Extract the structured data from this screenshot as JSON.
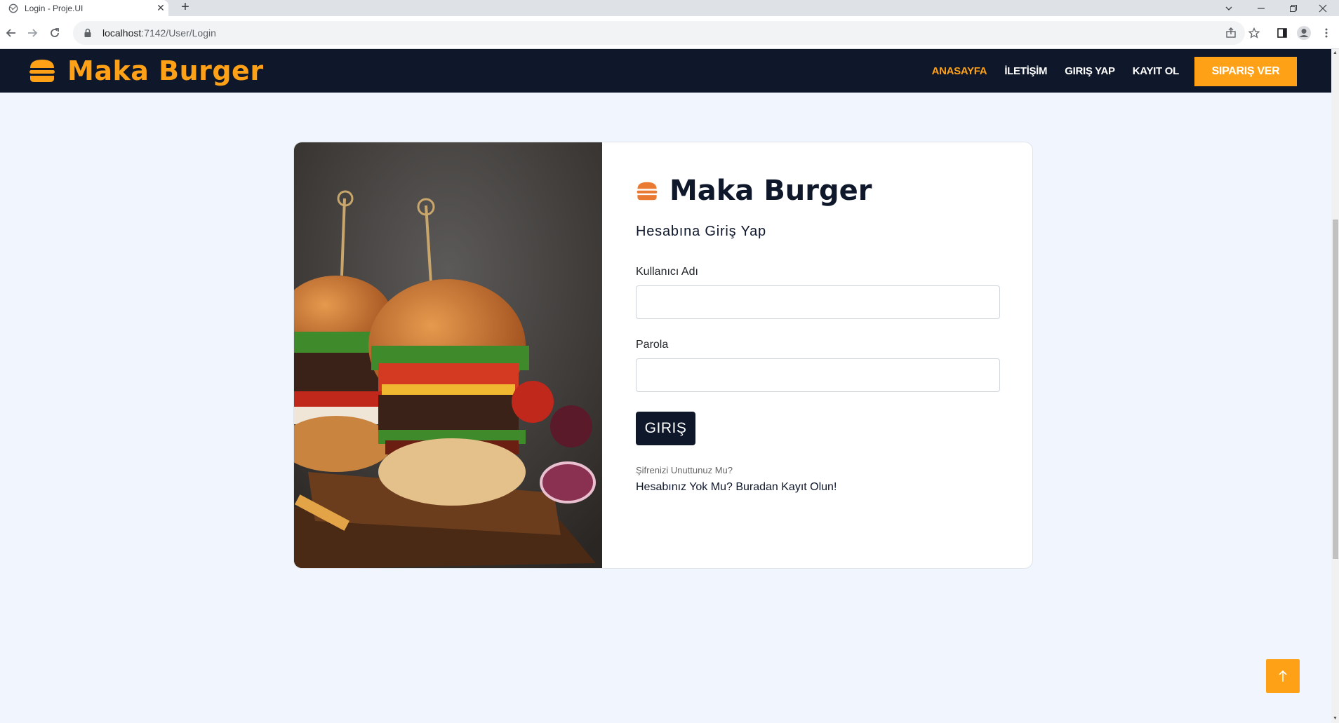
{
  "browser": {
    "tab_title": "Login - Proje.UI",
    "tab_close": "✕",
    "new_tab": "+",
    "url_host": "localhost",
    "url_path": ":7142/User/Login",
    "icons": [
      "globe-icon",
      "back-arrow-icon",
      "forward-arrow-icon",
      "reload-icon",
      "lock-icon",
      "share-icon",
      "star-icon",
      "sidepanel-icon",
      "profile-icon",
      "kebab-menu-icon",
      "chevron-down-icon",
      "minimize-icon",
      "restore-icon",
      "close-icon"
    ]
  },
  "navbar": {
    "brand": "Maka Burger",
    "links": [
      {
        "label": "ANASAYFA",
        "active": true
      },
      {
        "label": "İLETİŞİM",
        "active": false
      },
      {
        "label": "GIRIŞ YAP",
        "active": false
      },
      {
        "label": "KAYIT OL",
        "active": false
      }
    ],
    "order_button": "SIPARIŞ VER"
  },
  "login": {
    "brand": "Maka Burger",
    "subtitle": "Hesabına Giriş Yap",
    "username_label": "Kullanıcı Adı",
    "username_value": "",
    "password_label": "Parola",
    "password_value": "",
    "submit_label": "GIRIŞ",
    "forgot_link": "Şifrenizi Unuttunuz Mu?",
    "register_link": "Hesabınız Yok Mu? Buradan Kayıt Olun!"
  },
  "colors": {
    "accent": "#fea116",
    "dark": "#0f172b",
    "background": "#f1f6fe"
  },
  "back_to_top_icon": "arrow-up-icon"
}
